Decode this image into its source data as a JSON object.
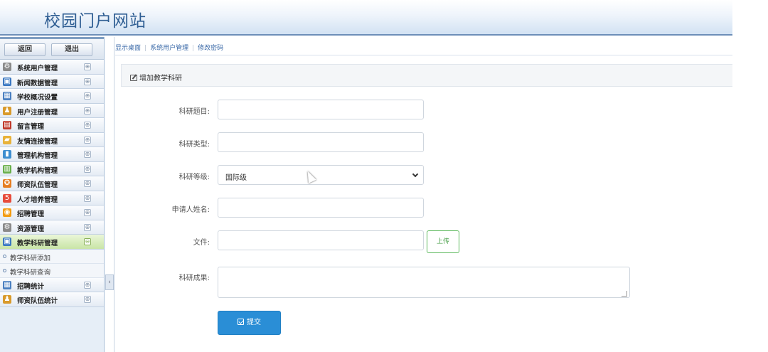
{
  "header": {
    "site_title": "校园门户网站"
  },
  "sidebar": {
    "back_label": "返回",
    "exit_label": "退出",
    "menu": [
      {
        "label": "系统用户管理",
        "icon": "gear-icon",
        "color": "#8a8a8a",
        "glyph": "⚙",
        "toggle": "⊕"
      },
      {
        "label": "新闻数据管理",
        "icon": "monitor-icon",
        "color": "#3a78c2",
        "glyph": "▣",
        "toggle": "⊕"
      },
      {
        "label": "学校概况设置",
        "icon": "table-icon",
        "color": "#4a7fc0",
        "glyph": "▦",
        "toggle": "⊕"
      },
      {
        "label": "用户注册管理",
        "icon": "user-icon",
        "color": "#d99a2b",
        "glyph": "♟",
        "toggle": "⊕"
      },
      {
        "label": "留言管理",
        "icon": "message-icon",
        "color": "#c0392b",
        "glyph": "▤",
        "toggle": "⊕"
      },
      {
        "label": "友情连接管理",
        "icon": "folder-icon",
        "color": "#e8b23a",
        "glyph": "▰",
        "toggle": "⊕"
      },
      {
        "label": "管理机构管理",
        "icon": "bar-chart-icon",
        "color": "#3d8ed0",
        "glyph": "▮",
        "toggle": "⊕"
      },
      {
        "label": "教学机构管理",
        "icon": "board-icon",
        "color": "#6ab04c",
        "glyph": "▥",
        "toggle": "⊕"
      },
      {
        "label": "师资队伍管理",
        "icon": "badge-icon",
        "color": "#e67e22",
        "glyph": "✪",
        "toggle": "⊕"
      },
      {
        "label": "人才培养管理",
        "icon": "number-icon",
        "color": "#e74c3c",
        "glyph": "5",
        "toggle": "⊕"
      },
      {
        "label": "招聘管理",
        "icon": "circle-icon",
        "color": "#f39c12",
        "glyph": "◉",
        "toggle": "⊕"
      },
      {
        "label": "资源管理",
        "icon": "cog-icon",
        "color": "#8a8a8a",
        "glyph": "⚙",
        "toggle": "⊕"
      },
      {
        "label": "教学科研管理",
        "icon": "monitor-icon",
        "color": "#3a78c2",
        "glyph": "▣",
        "toggle": "⊖"
      }
    ],
    "submenu": [
      {
        "label": "教学科研添加"
      },
      {
        "label": "教学科研查询"
      }
    ],
    "menu_after": [
      {
        "label": "招聘统计",
        "icon": "table-icon",
        "color": "#4a7fc0",
        "glyph": "▦",
        "toggle": "⊕"
      },
      {
        "label": "师资队伍统计",
        "icon": "user-icon",
        "color": "#d99a2b",
        "glyph": "♟",
        "toggle": "⊕"
      }
    ],
    "collapse_glyph": "‹"
  },
  "breadcrumb": [
    "显示桌面",
    "系统用户管理",
    "修改密码"
  ],
  "panel": {
    "title": "增加教学科研",
    "fields": {
      "research_title_label": "科研题目:",
      "research_title_value": "",
      "research_type_label": "科研类型:",
      "research_type_value": "",
      "research_level_label": "科研等级:",
      "research_level_value": "国际级",
      "applicant_label": "申请人姓名:",
      "applicant_value": "",
      "file_label": "文件:",
      "file_value": "",
      "upload_label": "上传",
      "result_label": "科研成果:",
      "result_value": ""
    },
    "submit_label": "提交"
  }
}
